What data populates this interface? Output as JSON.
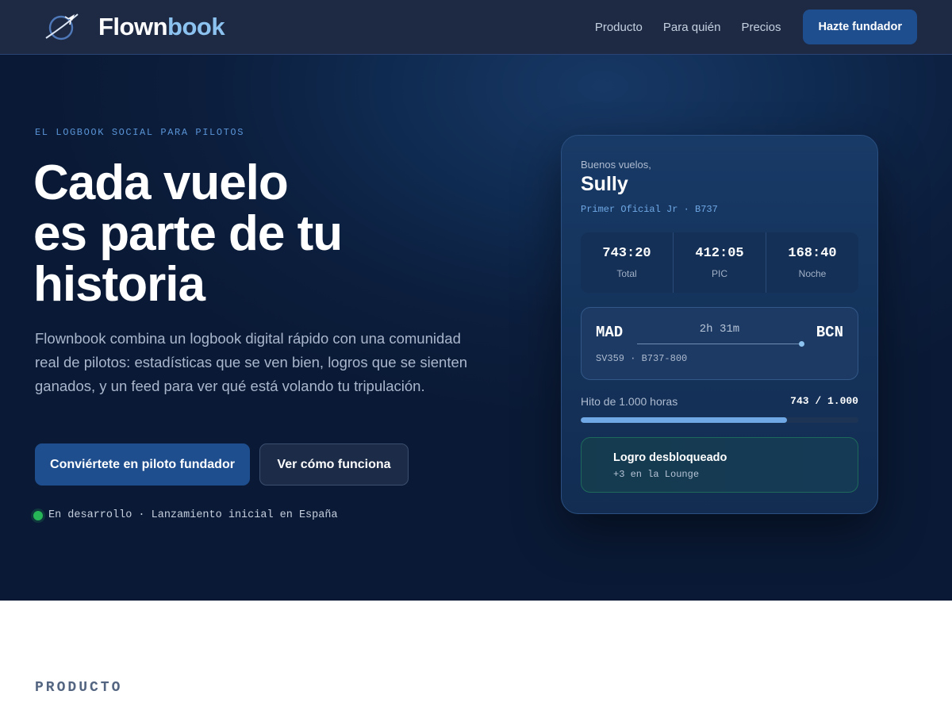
{
  "header": {
    "brand_part1": "Flown",
    "brand_part2": "book",
    "logo_icon": "planet-airplane-icon",
    "nav": [
      {
        "label": "Producto"
      },
      {
        "label": "Para quién"
      },
      {
        "label": "Precios"
      }
    ],
    "cta_label": "Hazte fundador"
  },
  "hero": {
    "eyebrow": "EL LOGBOOK SOCIAL PARA PILOTOS",
    "headline": [
      "Cada vuelo",
      "es parte de tu",
      "historia"
    ],
    "lead": "Flownbook combina un logbook digital rápido con una comunidad real de pilotos: estadísticas que se ven bien, logros que se sienten ganados, y un feed para ver qué está volando tu tripulación.",
    "primary_button": "Conviértete en piloto fundador",
    "secondary_button": "Ver cómo funciona",
    "status_text": "En desarrollo · Lanzamiento inicial en España"
  },
  "card": {
    "greeting": "Buenos vuelos,",
    "name": "Sully",
    "role": "Primer Oficial Jr · B737",
    "stats": [
      {
        "value": "743:20",
        "label": "Total"
      },
      {
        "value": "412:05",
        "label": "PIC"
      },
      {
        "value": "168:40",
        "label": "Noche"
      }
    ],
    "route": {
      "from": "MAD",
      "to": "BCN",
      "duration": "2h 31m",
      "flight": "SV359 · B737-800"
    },
    "milestone": {
      "label": "Hito de 1.000 horas",
      "value_text": "743 / 1.000",
      "progress": 0.743
    },
    "achievement": {
      "title": "Logro desbloqueado",
      "subtitle": "+3 en la Lounge"
    }
  },
  "section": {
    "eyebrow": "PRODUCTO"
  },
  "colors": {
    "brand_accent": "#8cc2f0",
    "primary_button": "#1f4e8f",
    "status_green": "#27b657",
    "hero_background": "#0c1e3d"
  }
}
